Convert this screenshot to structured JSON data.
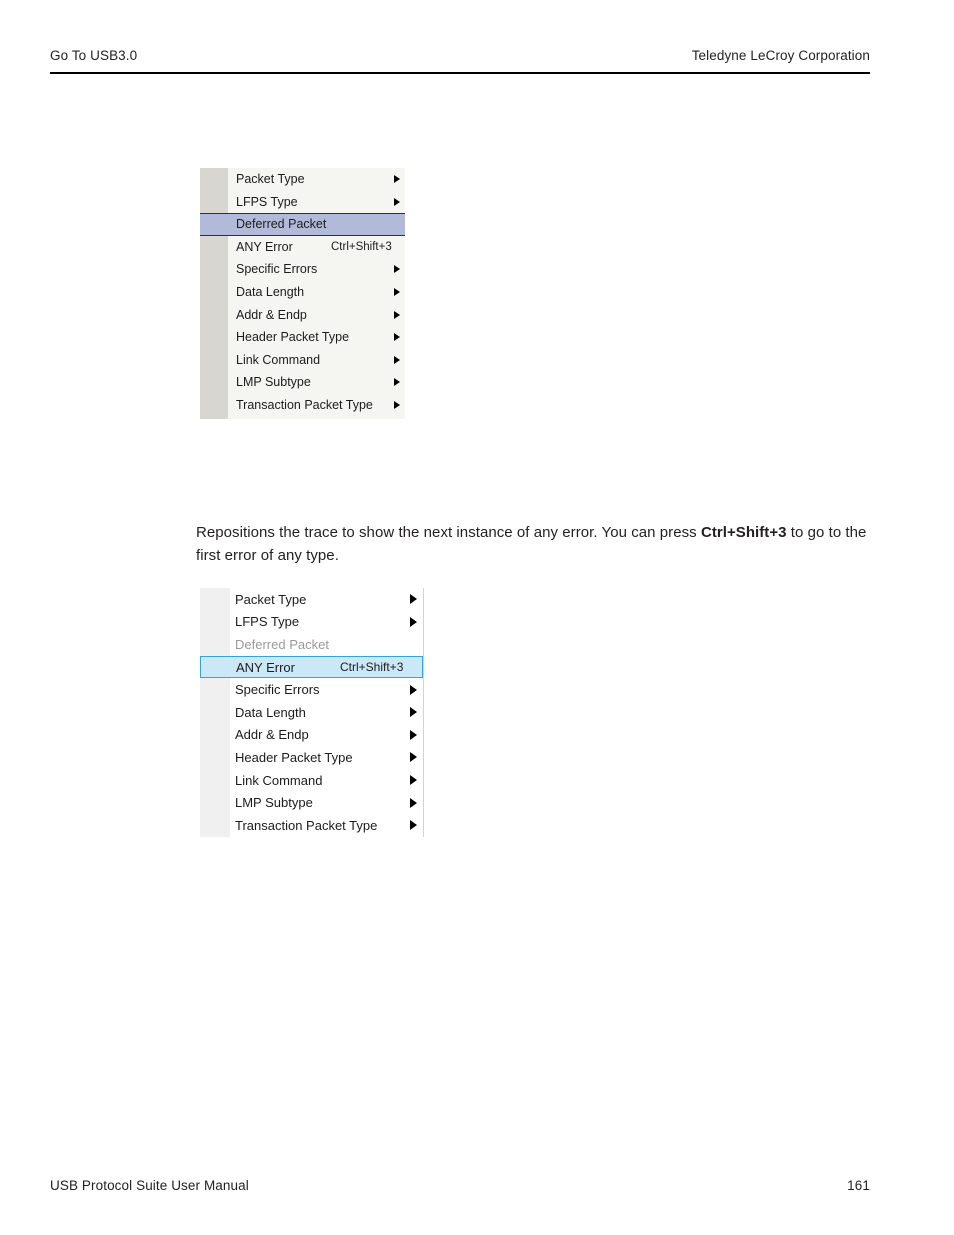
{
  "header": {
    "left": "Go To USB3.0",
    "right": "Teledyne LeCroy Corporation"
  },
  "footer": {
    "left": "USB Protocol Suite User Manual",
    "page_number": "161"
  },
  "body": {
    "paragraph_part1": "Repositions the trace to show the next instance of any error. You can press ",
    "paragraph_bold": "Ctrl+Shift+3",
    "paragraph_part2": " to go to the first error of any type."
  },
  "colors": {
    "menu_one_highlight_fill": "#b2bad9",
    "menu_one_highlight_border": "#1f2f5e",
    "menu_one_gutter": "#d8d6d1",
    "menu_one_background": "#f5f5f2",
    "menu_two_highlight_fill": "#cbe8f7",
    "menu_two_highlight_border": "#39a0da",
    "menu_two_gutter": "#f0f0f0",
    "menu_two_background": "#ffffff",
    "disabled_text": "#9a9a9a",
    "text": "#1c1c1c"
  },
  "menu_one": {
    "name": "Go To context menu with Deferred Packet highlighted",
    "items": [
      {
        "label": "Packet Type",
        "shortcut": "",
        "submenu": true,
        "state": "normal"
      },
      {
        "label": "LFPS Type",
        "shortcut": "",
        "submenu": true,
        "state": "normal"
      },
      {
        "label": "Deferred Packet",
        "shortcut": "",
        "submenu": false,
        "state": "selected"
      },
      {
        "label": "ANY Error",
        "shortcut": "Ctrl+Shift+3",
        "submenu": false,
        "state": "normal"
      },
      {
        "label": "Specific Errors",
        "shortcut": "",
        "submenu": true,
        "state": "normal"
      },
      {
        "label": "Data Length",
        "shortcut": "",
        "submenu": true,
        "state": "normal"
      },
      {
        "label": "Addr & Endp",
        "shortcut": "",
        "submenu": true,
        "state": "normal"
      },
      {
        "label": "Header Packet Type",
        "shortcut": "",
        "submenu": true,
        "state": "normal"
      },
      {
        "label": "Link Command",
        "shortcut": "",
        "submenu": true,
        "state": "normal"
      },
      {
        "label": "LMP Subtype",
        "shortcut": "",
        "submenu": true,
        "state": "normal"
      },
      {
        "label": "Transaction Packet Type",
        "shortcut": "",
        "submenu": true,
        "state": "normal"
      }
    ]
  },
  "menu_two": {
    "name": "Go To context menu with ANY Error highlighted",
    "items": [
      {
        "label": "Packet Type",
        "shortcut": "",
        "submenu": true,
        "state": "normal"
      },
      {
        "label": "LFPS Type",
        "shortcut": "",
        "submenu": true,
        "state": "normal"
      },
      {
        "label": "Deferred Packet",
        "shortcut": "",
        "submenu": false,
        "state": "disabled"
      },
      {
        "label": "ANY Error",
        "shortcut": "Ctrl+Shift+3",
        "submenu": false,
        "state": "selected"
      },
      {
        "label": "Specific Errors",
        "shortcut": "",
        "submenu": true,
        "state": "normal"
      },
      {
        "label": "Data Length",
        "shortcut": "",
        "submenu": true,
        "state": "normal"
      },
      {
        "label": "Addr & Endp",
        "shortcut": "",
        "submenu": true,
        "state": "normal"
      },
      {
        "label": "Header Packet Type",
        "shortcut": "",
        "submenu": true,
        "state": "normal"
      },
      {
        "label": "Link Command",
        "shortcut": "",
        "submenu": true,
        "state": "normal"
      },
      {
        "label": "LMP Subtype",
        "shortcut": "",
        "submenu": true,
        "state": "normal"
      },
      {
        "label": "Transaction Packet Type",
        "shortcut": "",
        "submenu": true,
        "state": "normal"
      }
    ]
  }
}
